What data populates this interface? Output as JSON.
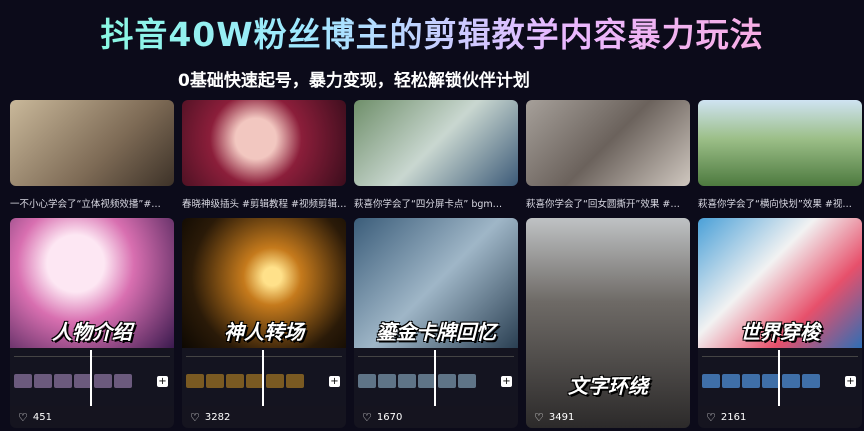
{
  "headline": "抖音40W粉丝博主的剪辑教学内容暴力玩法",
  "subtitle": "0基础快速起号，暴力变现，轻松解锁伙伴计划",
  "top_cards": [
    {
      "badge": "",
      "caption": "一不小心学会了“立体视频效播”#…"
    },
    {
      "badge": "",
      "caption": "春晓神级插头 #剪辑教程 #视频剪辑…"
    },
    {
      "badge": "",
      "caption": "萩喜你学会了“四分屏卡点” bgm…"
    },
    {
      "badge": "",
      "caption": "萩喜你学会了“回女圆撕开”效果 #…"
    },
    {
      "badge": "",
      "caption": "萩喜你学会了“横向快划”效果 #视…"
    }
  ],
  "bottom_cards": [
    {
      "title": "人物介绍",
      "likes": "451"
    },
    {
      "title": "神人转场",
      "likes": "3282"
    },
    {
      "title": "鎏金卡牌回忆",
      "likes": "1670"
    },
    {
      "title": "文字环绕",
      "likes": "3491"
    },
    {
      "title": "世界穿梭",
      "likes": "2161"
    }
  ],
  "icons": {
    "heart": "heart-icon",
    "add": "add-icon"
  }
}
